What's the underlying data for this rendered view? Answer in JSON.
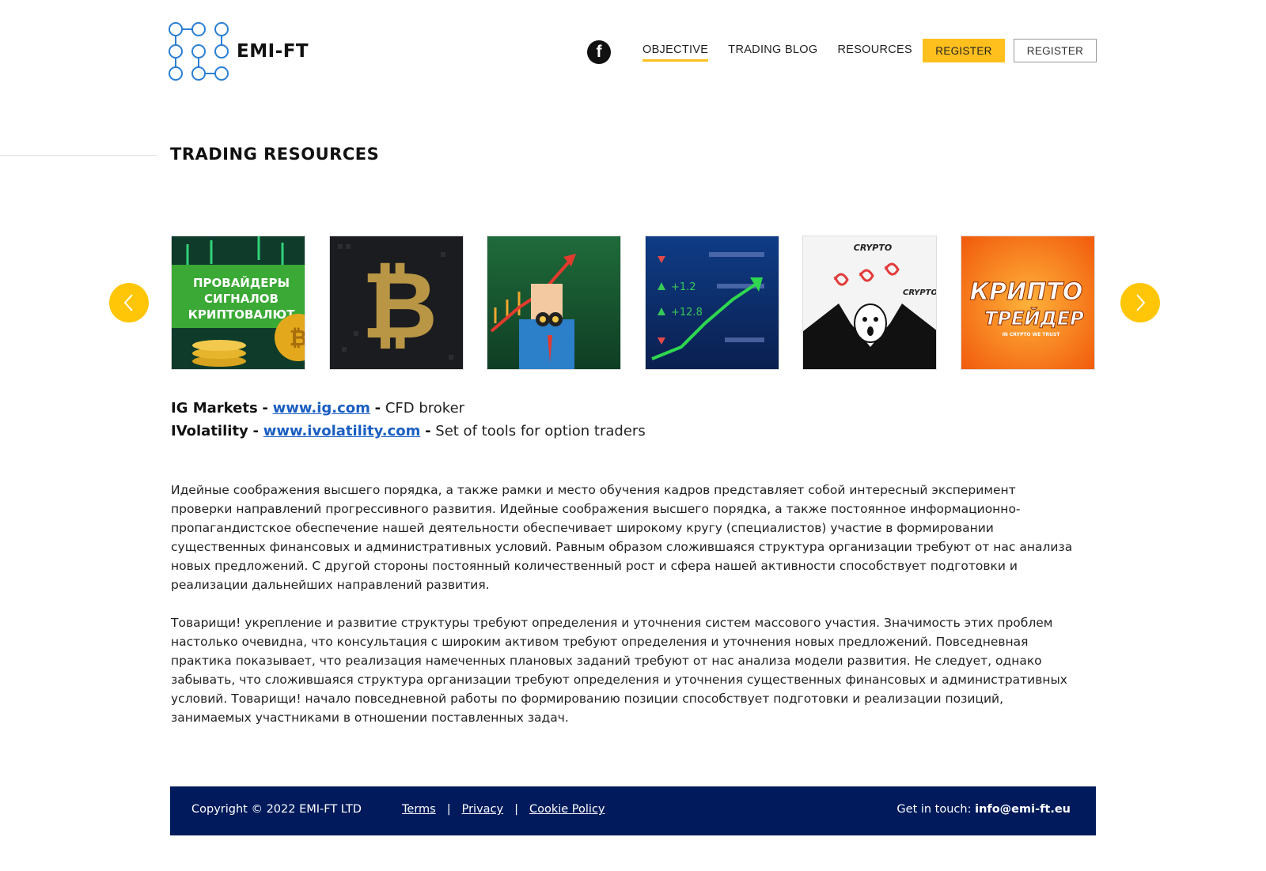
{
  "header": {
    "logo_text": "EMI-FT",
    "nav": [
      "OBJECTIVE",
      "TRADING BLOG",
      "RESOURCES"
    ],
    "buttons": [
      "REGISTER",
      "REGISTER"
    ]
  },
  "section": {
    "title": "TRADING RESOURCES"
  },
  "carousel": {
    "slides": [
      {
        "text_lines": [
          "ПРОВАЙДЕРЫ",
          "СИГНАЛОВ",
          "КРИПТОВАЛЮТ"
        ]
      },
      {
        "text_lines": []
      },
      {
        "text_lines": []
      },
      {
        "text_lines": [
          "+1.2",
          "+12.8"
        ]
      },
      {
        "text_lines": [
          "CRYPTO",
          "CRYPTO"
        ]
      },
      {
        "text_lines": [
          "КРИПТО",
          "ТРЕЙДЕР",
          "IN CRYPTO WE TRUST"
        ]
      }
    ]
  },
  "resources": [
    {
      "name": "IG Markets",
      "sep": "-",
      "link": "www.ig.com",
      "desc": "CFD broker"
    },
    {
      "name": "IVolatility",
      "sep": "-",
      "link": "www.ivolatility.com",
      "desc": "Set of tools for option traders"
    }
  ],
  "paragraphs": [
    "Идейные соображения высшего порядка, а также рамки и место обучения кадров представляет собой интересный эксперимент проверки направлений прогрессивного развития. Идейные соображения высшего порядка, а также постоянное информационно-пропагандистское обеспечение нашей деятельности обеспечивает широкому кругу (специалистов) участие в формировании существенных финансовых и административных условий. Равным образом сложившаяся структура организации требуют от нас анализа новых предложений. С другой стороны постоянный количественный рост и сфера нашей активности способствует подготовки и реализации дальнейших направлений развития.",
    "Товарищи! укрепление и развитие структуры требуют определения и уточнения систем массового участия. Значимость этих проблем настолько очевидна, что консультация с широким активом требуют определения и уточнения новых предложений. Повседневная практика показывает, что реализация намеченных плановых заданий требуют от нас анализа модели развития. Не следует, однако забывать, что сложившаяся структура организации требуют определения и уточнения существенных финансовых и административных условий. Товарищи! начало повседневной работы по формированию позиции способствует подготовки и реализации позиций, занимаемых участниками в отношении поставленных задач."
  ],
  "footer": {
    "copyright": "Copyright © 2022 EMI-FT LTD",
    "links": [
      "Terms",
      "Privacy",
      "Cookie Policy"
    ],
    "separator": "|",
    "contact_label": "Get in touch:",
    "contact_email": "info@emi-ft.eu"
  },
  "colors": {
    "accent": "#ffc01e",
    "footer_bg": "#001a5c",
    "link": "#1a5ec2",
    "logo_blue": "#2a7fd4"
  },
  "icons": [
    "facebook-icon",
    "chevron-left-icon",
    "chevron-right-icon"
  ]
}
